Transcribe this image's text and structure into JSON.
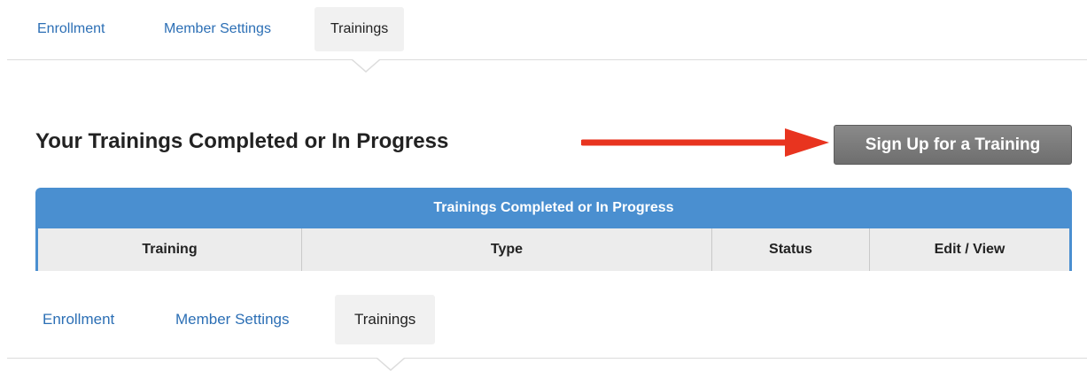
{
  "tabs_top": [
    {
      "label": "Enrollment"
    },
    {
      "label": "Member Settings"
    },
    {
      "label": "Trainings",
      "active": true
    }
  ],
  "tabs_bottom": [
    {
      "label": "Enrollment"
    },
    {
      "label": "Member Settings"
    },
    {
      "label": "Trainings",
      "active": true
    }
  ],
  "section": {
    "title": "Your Trainings Completed or In Progress",
    "signup_button": "Sign Up for a Training"
  },
  "table": {
    "caption": "Trainings Completed or In Progress",
    "columns": [
      "Training",
      "Type",
      "Status",
      "Edit / View"
    ]
  },
  "annotation": {
    "arrow_color": "#e8341f",
    "arrow_target": "signup-button"
  },
  "colors": {
    "link": "#2c6fb5",
    "table_header": "#4a8fd0",
    "button": "#777777",
    "tab_active_bg": "#f1f1f1"
  }
}
